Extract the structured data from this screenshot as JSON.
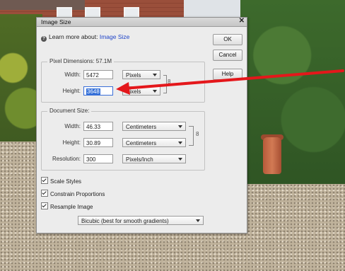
{
  "dialog": {
    "title": "Image Size",
    "learn_prefix": "Learn more about:",
    "learn_link": "Image Size",
    "buttons": {
      "ok": "OK",
      "cancel": "Cancel",
      "help": "Help"
    },
    "pixel_dimensions": {
      "legend": "Pixel Dimensions: 57.1M",
      "width_label": "Width:",
      "width_value": "5472",
      "width_unit": "Pixels",
      "height_label": "Height:",
      "height_value": "3648",
      "height_unit": "Pixels"
    },
    "document_size": {
      "legend": "Document Size:",
      "width_label": "Width:",
      "width_value": "46.33",
      "width_unit": "Centimeters",
      "height_label": "Height:",
      "height_value": "30.89",
      "height_unit": "Centimeters",
      "resolution_label": "Resolution:",
      "resolution_value": "300",
      "resolution_unit": "Pixels/Inch"
    },
    "options": {
      "scale_styles": "Scale Styles",
      "constrain_proportions": "Constrain Proportions",
      "resample_image": "Resample Image",
      "resample_method": "Bicubic (best for smooth gradients)"
    }
  },
  "annotation": {
    "arrow_color": "#e4171b"
  }
}
